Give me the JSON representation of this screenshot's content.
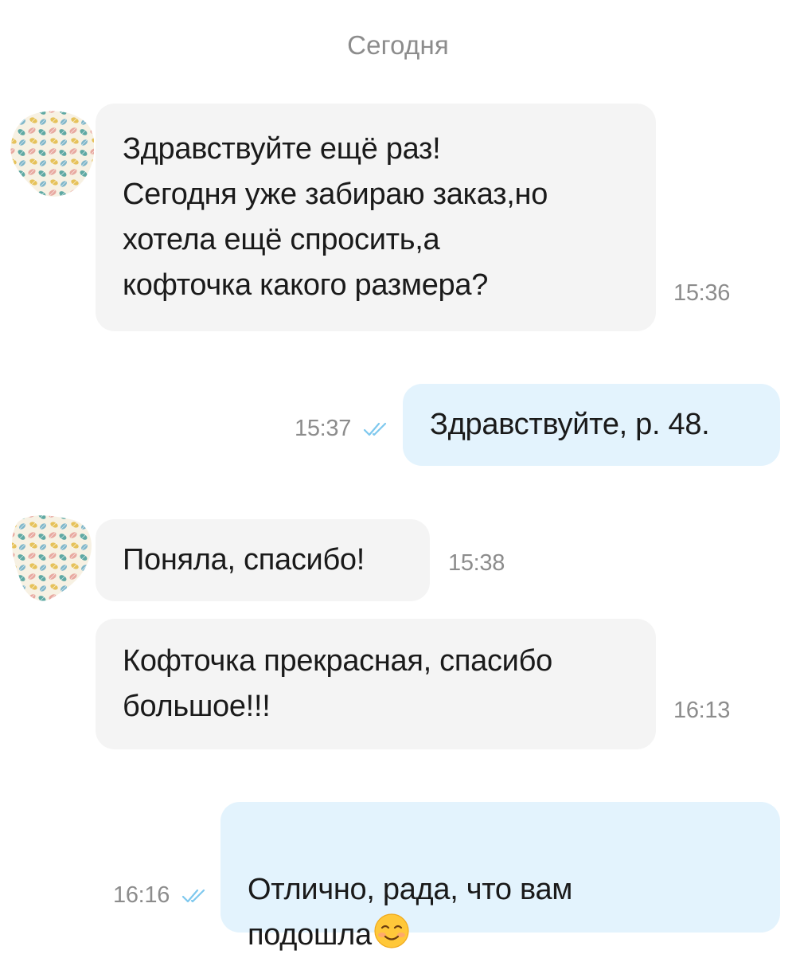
{
  "date_separator": "Сегодня",
  "messages": [
    {
      "direction": "incoming",
      "text": "Здравствуйте ещё раз!\nСегодня  уже забираю заказ,но\nхотела ещё спросить,а\nкофточка какого размера?",
      "time": "15:36"
    },
    {
      "direction": "outgoing",
      "text": "Здравствуйте, р. 48.",
      "time": "15:37",
      "status": "read"
    },
    {
      "direction": "incoming",
      "text": "Поняла, спасибо!",
      "time": "15:38"
    },
    {
      "direction": "incoming",
      "text": "Кофточка прекрасная, спасибо\nбольшое!!!",
      "time": "16:13"
    },
    {
      "direction": "outgoing",
      "text": "Отлично, рада, что вам\nподошла",
      "emoji": "smiling-face-emoji",
      "time": "16:16",
      "status": "read"
    }
  ],
  "colors": {
    "incoming_bubble": "#f4f4f4",
    "outgoing_bubble": "#e3f3fd",
    "timestamp": "#8c8c8c",
    "read_ticks": "#7ec8ee"
  },
  "icons": {
    "avatar": "contact-avatar-leaf-pattern",
    "read_status": "double-check-icon"
  }
}
